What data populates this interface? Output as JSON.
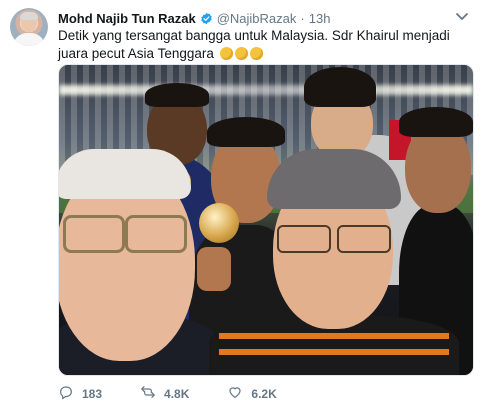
{
  "tweet": {
    "name": "Mohd Najib Tun Razak",
    "handle": "@NajibRazak",
    "separator": "·",
    "time": "13h",
    "text": "Detik yang tersangat bangga untuk Malaysia. Sdr Khairul menjadi juara pecut Asia Tenggara",
    "emoji": [
      "clapping-hands",
      "clapping-hands",
      "clapping-hands"
    ],
    "photo_description_icon": "selfie-photo"
  },
  "actions": {
    "replies": "183",
    "retweets": "4.8K",
    "likes": "6.2K"
  },
  "colors": {
    "verified": "#1da1f2",
    "muted": "#657786",
    "text": "#14171a"
  }
}
